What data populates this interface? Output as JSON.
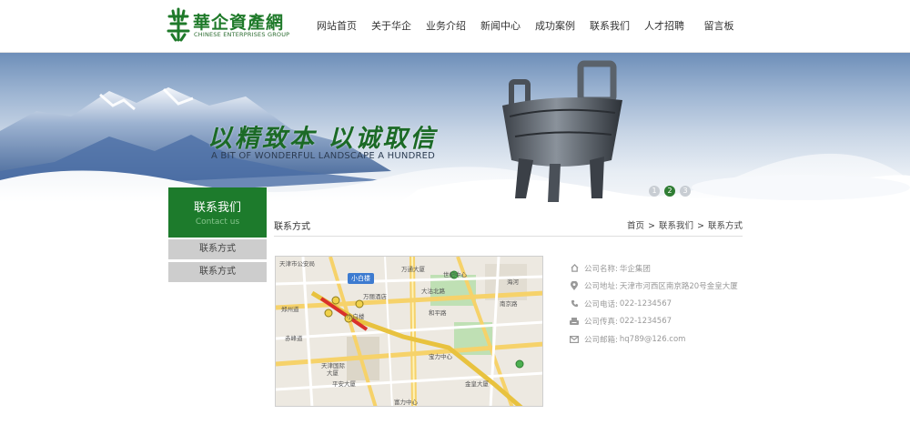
{
  "header": {
    "logo_cn": "華企資產網",
    "logo_en": "CHINESE ENTERPRISES GROUP",
    "nav": [
      "网站首页",
      "关于华企",
      "业务介绍",
      "新闻中心",
      "成功案例",
      "联系我们",
      "人才招聘",
      "留言板"
    ]
  },
  "banner": {
    "slogan": "以精致本 以诚取信",
    "slogan_en": "A BIT OF WONDERFUL LANDSCAPE A HUNDRED",
    "dots": [
      "1",
      "2",
      "3"
    ],
    "active_dot": 2
  },
  "sidebar": {
    "title": "联系我们",
    "subtitle": "Contact us",
    "items": [
      "联系方式",
      "联系方式"
    ]
  },
  "content": {
    "title": "联系方式",
    "breadcrumb": [
      "首页",
      "联系我们",
      "联系方式"
    ],
    "breadcrumb_sep": ">"
  },
  "map": {
    "tag": "小白楼",
    "labels": [
      "天津市公安局",
      "万通大厦",
      "世纪中心",
      "万丽酒店",
      "郑州道",
      "小白楼",
      "天津国际",
      "大厦",
      "平安大厦",
      "宝力中心",
      "富力中心",
      "金皇大厦",
      "海河",
      "和平路",
      "大沽北路",
      "南京路",
      "赤峰道"
    ]
  },
  "contact": {
    "rows": [
      {
        "icon": "home-icon",
        "label": "公司名称:",
        "value": "华企集团"
      },
      {
        "icon": "location-pin-icon",
        "label": "公司地址:",
        "value": "天津市河西区南京路20号金皇大厦"
      },
      {
        "icon": "phone-icon",
        "label": "公司电话:",
        "value": "022-1234567"
      },
      {
        "icon": "fax-icon",
        "label": "公司传真:",
        "value": "022-1234567"
      },
      {
        "icon": "mail-icon",
        "label": "公司邮箱:",
        "value": "hq789@126.com"
      }
    ]
  },
  "colors": {
    "brand_green": "#1d7b2c",
    "side_grey": "#cdcdcd",
    "active_dot": "#2f7d33"
  }
}
